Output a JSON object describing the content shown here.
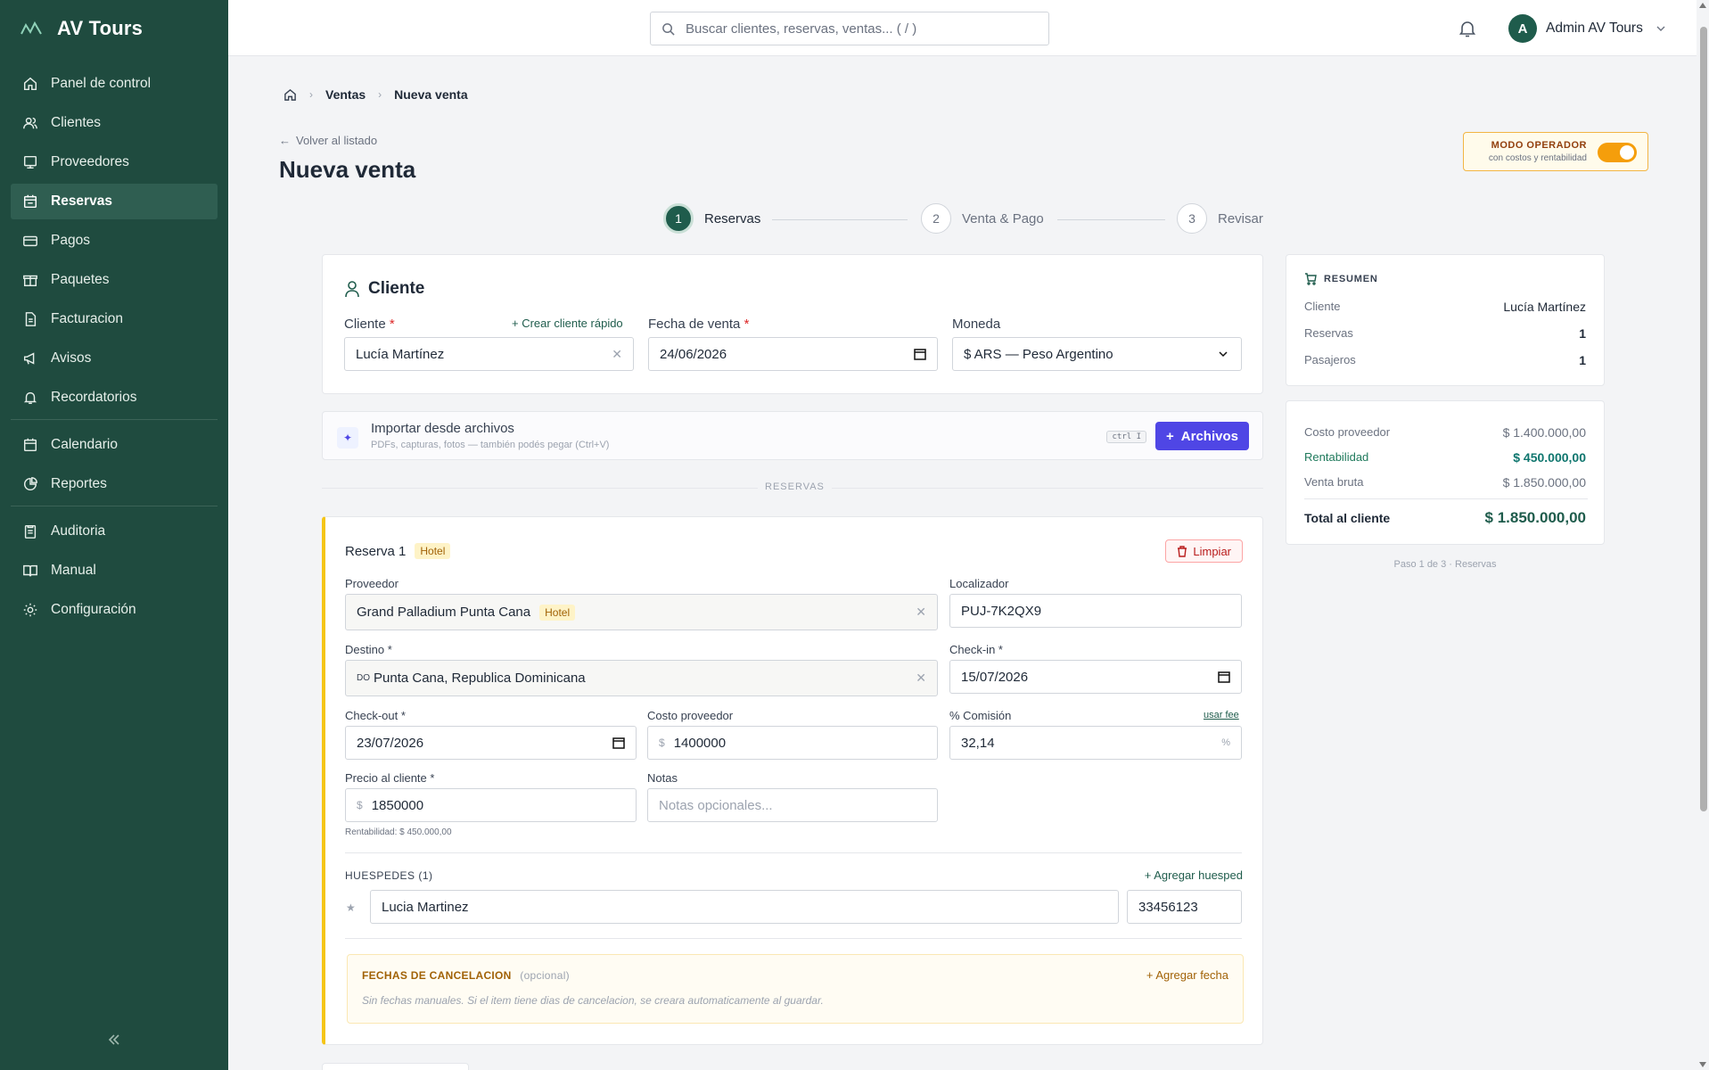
{
  "app": {
    "name": "AV Tours"
  },
  "sidebar": {
    "items": [
      {
        "label": "Panel de control",
        "icon": "home-icon"
      },
      {
        "label": "Clientes",
        "icon": "users-icon"
      },
      {
        "label": "Proveedores",
        "icon": "building-icon"
      },
      {
        "label": "Reservas",
        "icon": "calendar-check-icon",
        "active": true
      },
      {
        "label": "Pagos",
        "icon": "credit-card-icon"
      },
      {
        "label": "Paquetes",
        "icon": "gift-icon"
      },
      {
        "label": "Facturacion",
        "icon": "file-icon"
      },
      {
        "label": "Avisos",
        "icon": "megaphone-icon"
      },
      {
        "label": "Recordatorios",
        "icon": "bell-icon"
      },
      {
        "label": "Calendario",
        "icon": "calendar-icon"
      },
      {
        "label": "Reportes",
        "icon": "chart-pie-icon"
      },
      {
        "label": "Auditoria",
        "icon": "clipboard-icon"
      },
      {
        "label": "Manual",
        "icon": "book-icon"
      },
      {
        "label": "Configuración",
        "icon": "gear-icon"
      }
    ]
  },
  "topbar": {
    "search_placeholder": "Buscar clientes, reservas, ventas... ( / )",
    "user_initial": "A",
    "user_name": "Admin AV Tours"
  },
  "breadcrumb": {
    "level1": "Ventas",
    "level2": "Nueva venta"
  },
  "page": {
    "back_label": "Volver al listado",
    "title": "Nueva venta",
    "operator_mode_title": "MODO OPERADOR",
    "operator_mode_sub": "con costos y rentabilidad",
    "operator_mode_on": true
  },
  "stepper": [
    {
      "num": "1",
      "label": "Reservas"
    },
    {
      "num": "2",
      "label": "Venta & Pago"
    },
    {
      "num": "3",
      "label": "Revisar"
    }
  ],
  "cliente": {
    "heading": "Cliente",
    "cliente_label": "Cliente",
    "crear_rapido": "Crear cliente rápido",
    "cliente_value": "Lucía Martínez",
    "fecha_label": "Fecha de venta",
    "fecha_value": "24/06/2026",
    "moneda_label": "Moneda",
    "moneda_value": "$ ARS — Peso Argentino"
  },
  "import": {
    "title": "Importar desde archivos",
    "subtitle": "PDFs, capturas, fotos — también podés pegar (Ctrl+V)",
    "shortcut": "ctrl I",
    "button": "Archivos"
  },
  "section_divider": "RESERVAS",
  "reserva": {
    "title": "Reserva 1",
    "type_tag": "Hotel",
    "limpiar": "Limpiar",
    "proveedor_label": "Proveedor",
    "proveedor_value": "Grand Palladium Punta Cana",
    "proveedor_tag": "Hotel",
    "localizador_label": "Localizador",
    "localizador_value": "PUJ-7K2QX9",
    "destino_label": "Destino *",
    "destino_code": "DO",
    "destino_value": "Punta Cana, Republica Dominicana",
    "checkin_label": "Check-in *",
    "checkin_value": "15/07/2026",
    "checkout_label": "Check-out *",
    "checkout_value": "23/07/2026",
    "costo_label": "Costo proveedor",
    "costo_value": "1400000",
    "comision_label": "% Comisión",
    "usar_fee": "usar fee",
    "comision_value": "32,14",
    "precio_label": "Precio al cliente *",
    "precio_value": "1850000",
    "rentabilidad_note": "Rentabilidad: $ 450.000,00",
    "notas_label": "Notas",
    "notas_placeholder": "Notas opcionales...",
    "huespedes_label": "HUESPEDES (1)",
    "agregar_huesped": "+ Agregar huesped",
    "huesped_name": "Lucia Martinez",
    "huesped_doc": "33456123",
    "cancel_title": "FECHAS DE CANCELACION",
    "cancel_optional": "(opcional)",
    "cancel_add": "+ Agregar fecha",
    "cancel_note": "Sin fechas manuales. Si el item tiene dias de cancelacion, se creara automaticamente al guardar."
  },
  "currency_symbol": "$",
  "percent_symbol": "%",
  "summary": {
    "heading": "RESUMEN",
    "cliente_label": "Cliente",
    "cliente_value": "Lucía Martínez",
    "reservas_label": "Reservas",
    "reservas_value": "1",
    "pasajeros_label": "Pasajeros",
    "pasajeros_value": "1",
    "costo_label": "Costo proveedor",
    "costo_value": "$ 1.400.000,00",
    "rentabilidad_label": "Rentabilidad",
    "rentabilidad_value": "$ 450.000,00",
    "venta_label": "Venta bruta",
    "venta_value": "$ 1.850.000,00",
    "total_label": "Total al cliente",
    "total_value": "$ 1.850.000,00",
    "step_note": "Paso 1 de 3 · Reservas"
  },
  "colors": {
    "sidebar": "#1f4b3f",
    "accent": "#1f5c4c",
    "primary": "#4f46e5",
    "warning": "#f59e0b"
  }
}
